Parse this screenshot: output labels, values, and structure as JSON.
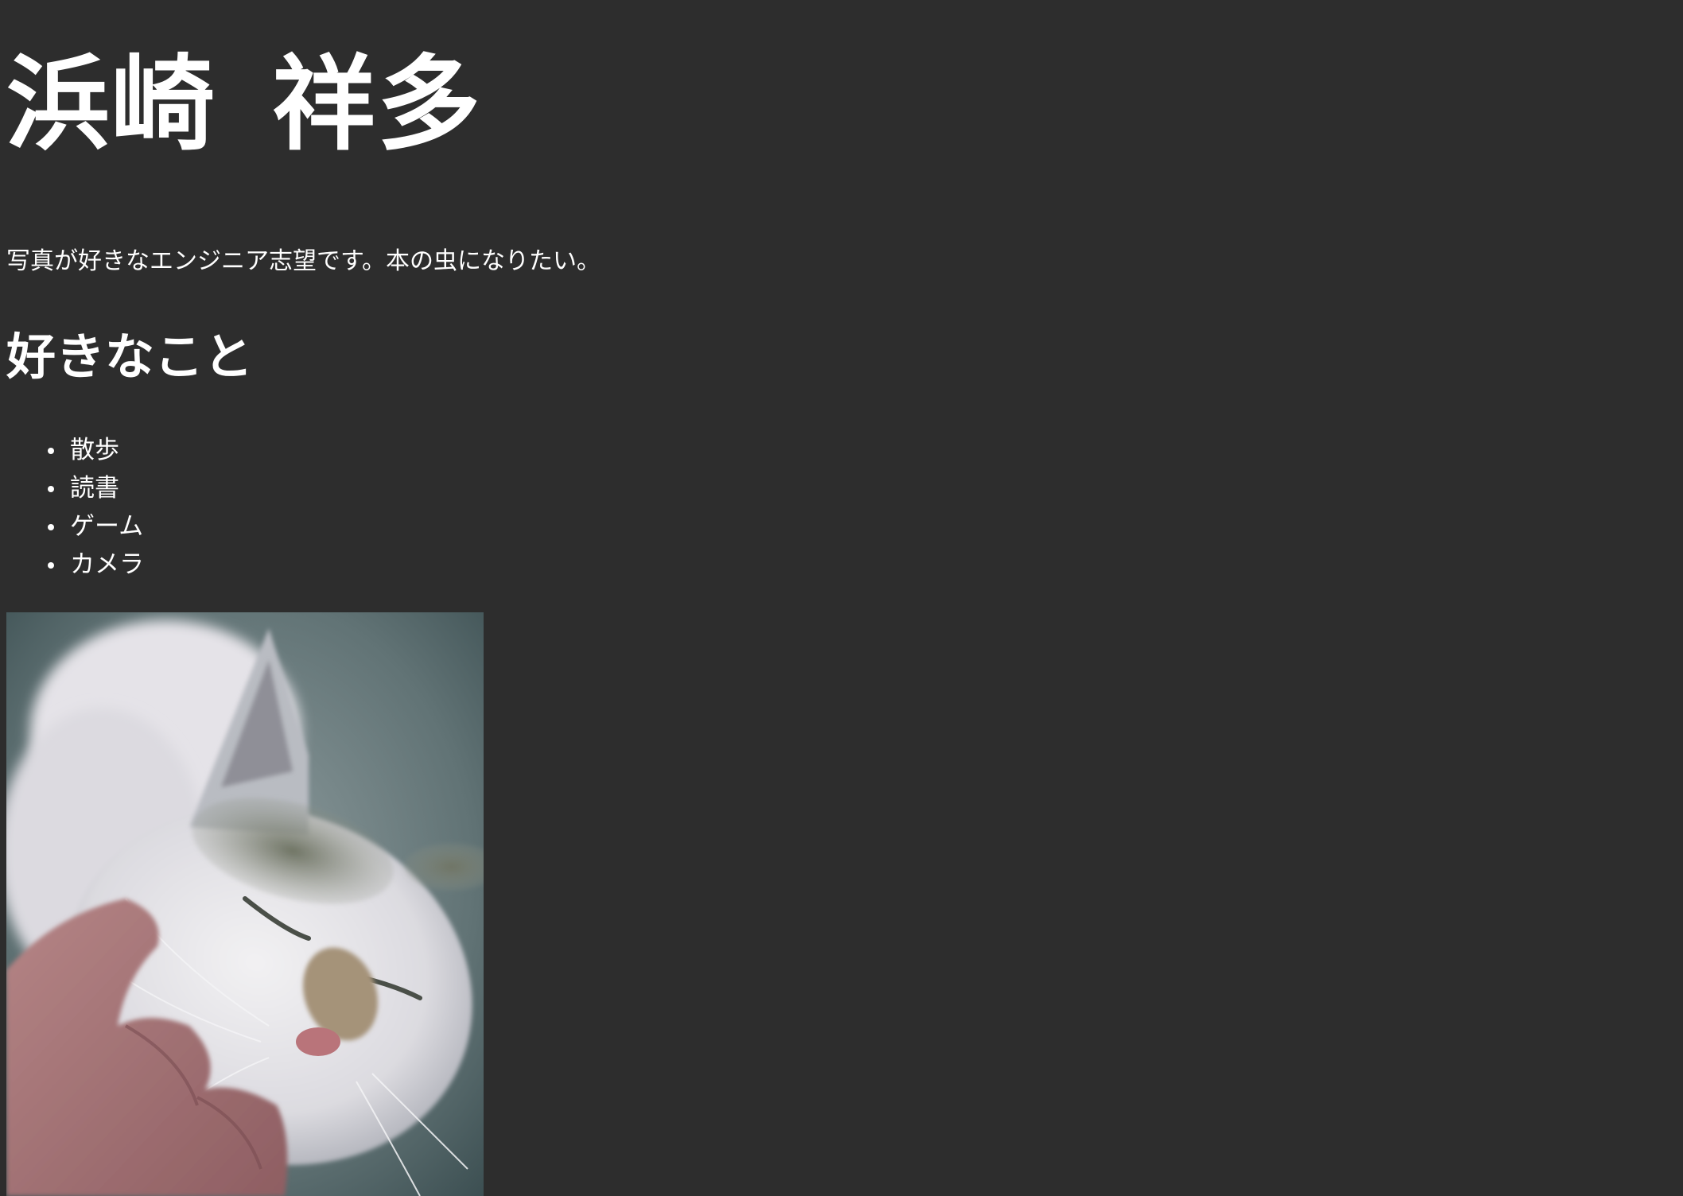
{
  "profile": {
    "family_name": "浜崎",
    "given_name": "祥多",
    "bio": "写真が好きなエンジニア志望です。本の虫になりたい。"
  },
  "likes": {
    "heading": "好きなこと",
    "items": [
      {
        "label": "散歩"
      },
      {
        "label": "読書"
      },
      {
        "label": "ゲーム"
      },
      {
        "label": "カメラ"
      }
    ]
  },
  "photo": {
    "subject": "cat-photo"
  },
  "colors": {
    "background": "#2d2d2d",
    "text": "#ffffff"
  }
}
